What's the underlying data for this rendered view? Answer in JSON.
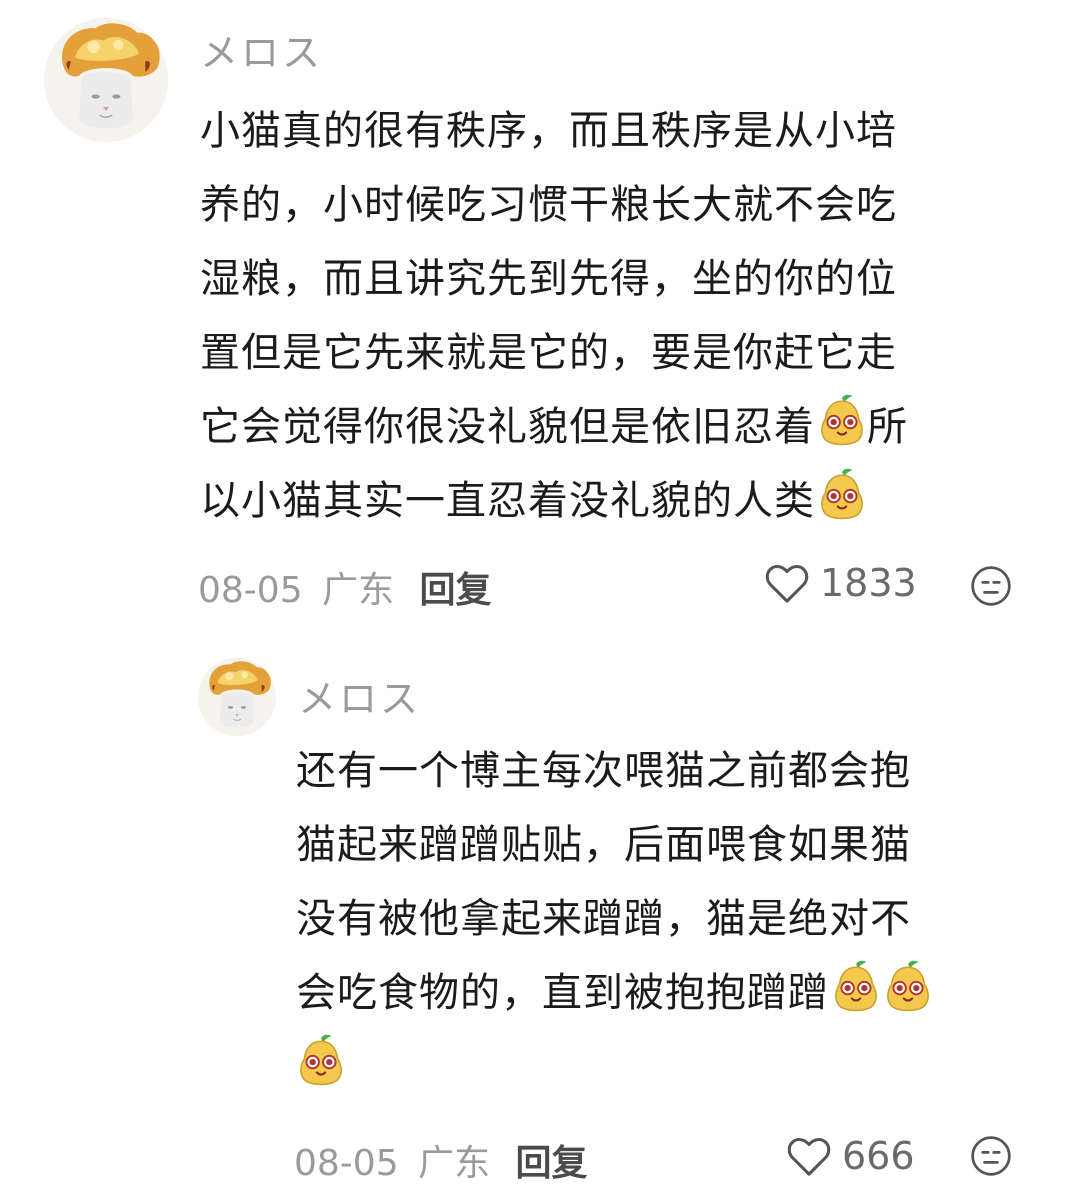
{
  "comments": [
    {
      "username": "メロス",
      "lines": [
        "小猫真的很有秩序，而且秩序是从小培",
        "养的，小时候吃习惯干粮长大就不会吃",
        "湿粮，而且讲究先到先得，坐的你的位",
        "置但是它先来就是它的，要是你赶它走"
      ],
      "line5_before": "它会觉得你很没礼貌但是依旧忍着",
      "line5_after": "所",
      "line6": "以小猫其实一直忍着没礼貌的人类",
      "date": "08-05",
      "location": "广东",
      "reply_label": "回复",
      "likes": "1833"
    },
    {
      "username": "メロス",
      "lines": [
        "还有一个博主每次喂猫之前都会抱",
        "猫起来蹭蹭贴贴，后面喂食如果猫",
        "没有被他拿起来蹭蹭，猫是绝对不"
      ],
      "line4": "会吃食物的，直到被抱抱蹭蹭",
      "date": "08-05",
      "location": "广东",
      "reply_label": "回复",
      "likes": "666"
    }
  ],
  "icons": {
    "like": "heart-outline-icon",
    "more": "neutral-face-icon",
    "emoji": "pear-face-emoji"
  },
  "colors": {
    "text": "#1b1b1b",
    "meta": "#9a9a9a",
    "background": "#ffffff"
  }
}
